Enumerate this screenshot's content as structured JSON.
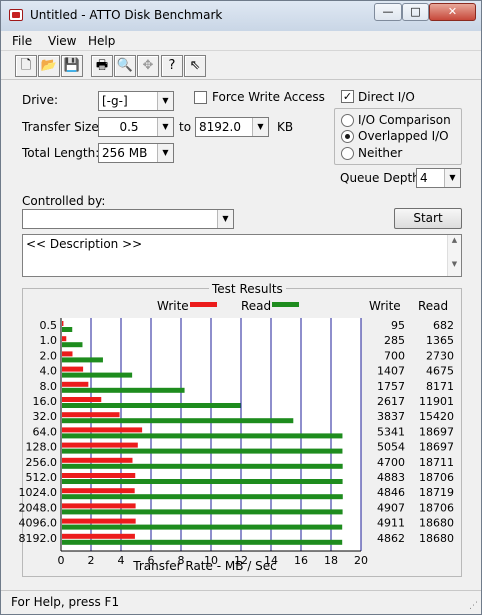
{
  "window": {
    "title": "Untitled - ATTO Disk Benchmark",
    "minimize": "—",
    "maximize": "□",
    "close": "✕"
  },
  "menu": {
    "file": "File",
    "view": "View",
    "help": "Help"
  },
  "toolbar": {
    "icons": [
      "new-icon",
      "open-icon",
      "save-icon",
      "print-icon",
      "print-preview-icon",
      "move-icon",
      "help-icon",
      "context-help-icon"
    ]
  },
  "form": {
    "drive_label": "Drive:",
    "drive_value": "[-g-]",
    "force_write_label": "Force Write Access",
    "direct_io_label": "Direct I/O",
    "direct_io_check": "✓",
    "transfer_size_label": "Transfer Size:",
    "transfer_from": "0.5",
    "to_label": "to",
    "transfer_to": "8192.0",
    "kb_label": "KB",
    "total_length_label": "Total Length:",
    "total_length_value": "256 MB",
    "io_comparison_label": "I/O Comparison",
    "overlapped_io_label": "Overlapped I/O",
    "neither_label": "Neither",
    "queue_depth_label": "Queue Depth:",
    "queue_depth_value": "4",
    "controlled_by_label": "Controlled by:",
    "controlled_by_value": "",
    "start_label": "Start",
    "description_text": "<< Description >>"
  },
  "results": {
    "title": "Test Results",
    "legend_write": "Write",
    "legend_read": "Read",
    "col_write": "Write",
    "col_read": "Read"
  },
  "status": {
    "text": "For Help, press F1"
  },
  "colors": {
    "write": "#ec1c1c",
    "read": "#1e8c1e",
    "grid": "#1c1c99",
    "accent": "#c62222"
  },
  "chart_data": {
    "type": "bar",
    "orientation": "horizontal",
    "categories": [
      "0.5",
      "1.0",
      "2.0",
      "4.0",
      "8.0",
      "16.0",
      "32.0",
      "64.0",
      "128.0",
      "256.0",
      "512.0",
      "1024.0",
      "2048.0",
      "4096.0",
      "8192.0"
    ],
    "series": [
      {
        "name": "Write",
        "values": [
          95,
          285,
          700,
          1407,
          1757,
          2617,
          3837,
          5341,
          5054,
          4700,
          4883,
          4846,
          4907,
          4911,
          4862
        ]
      },
      {
        "name": "Read",
        "values": [
          682,
          1365,
          2730,
          4675,
          8171,
          11901,
          15420,
          18697,
          18697,
          18711,
          18706,
          18719,
          18706,
          18680,
          18680
        ]
      }
    ],
    "xlabel": "Transfer Rate - MB / Sec",
    "xticks": [
      "0",
      "2",
      "4",
      "6",
      "8",
      "10",
      "12",
      "14",
      "16",
      "18",
      "20"
    ],
    "xlim": [
      0,
      20000
    ],
    "grid": true,
    "legend": "top-center"
  }
}
